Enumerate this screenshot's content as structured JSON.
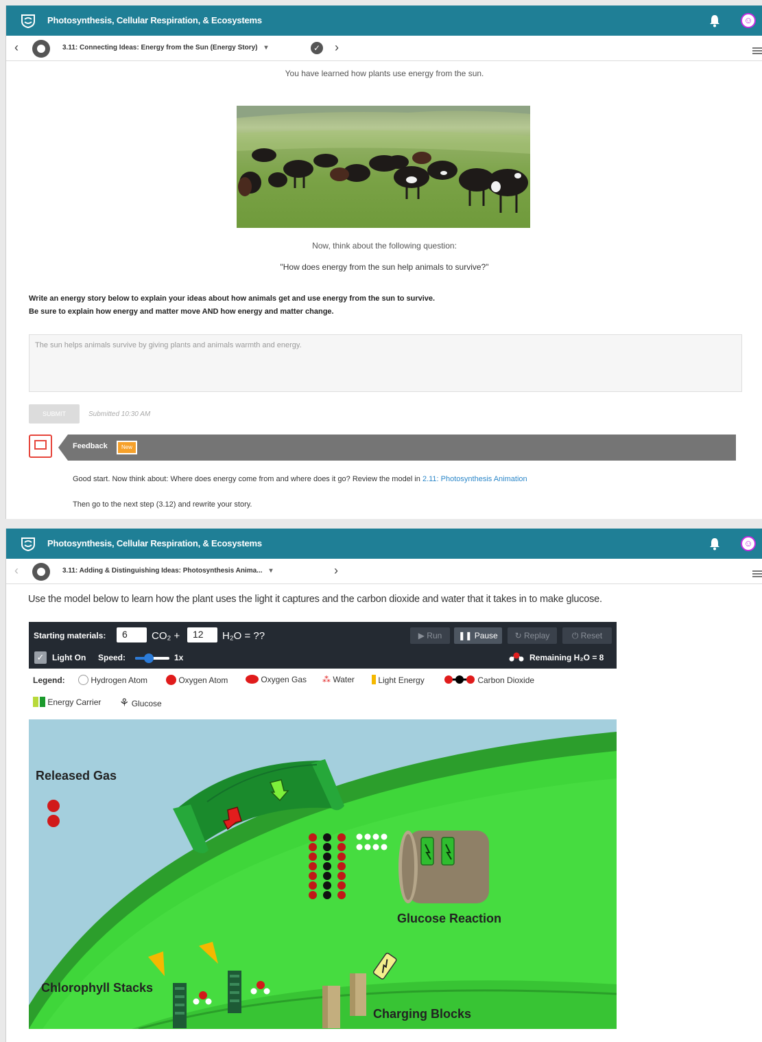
{
  "panel1": {
    "course_title": "Photosynthesis, Cellular Respiration, & Ecosystems",
    "step_title": "3.11: Connecting Ideas: Energy from the Sun (Energy Story)",
    "intro_text": "You have learned how plants use energy from the sun.",
    "think_text": "Now, think about the following question:",
    "question": "\"How does energy from the sun help animals to survive?\"",
    "prompt_line1": "Write an energy story below to explain your ideas about how animals get and use energy from the sun to survive.",
    "prompt_line2": "Be sure to explain how energy and matter move AND how energy and matter change.",
    "answer": "The sun helps animals survive by giving plants and animals warmth and energy.",
    "submit_label": "SUBMIT",
    "submitted_label": "Submitted 10:30 AM",
    "feedback_label": "Feedback",
    "feedback_badge": "New",
    "feedback_text": "Good start. Now think about: Where does energy come from and where does it go? Review the model in",
    "feedback_link": "2.11: Photosynthesis Animation",
    "feedback_text2": "Then go to the next step (3.12) and rewrite your story."
  },
  "panel2": {
    "course_title": "Photosynthesis, Cellular Respiration, & Ecosystems",
    "step_title": "3.11: Adding & Distinguishing Ideas: Photosynthesis Anima...",
    "intro_text": "Use the model below to learn how the plant uses the light it captures and the carbon dioxide and water that it takes in to make glucose.",
    "sim": {
      "starting_materials_label": "Starting materials:",
      "co2_value": "6",
      "co2_label": "CO₂ +",
      "h2o_value": "12",
      "h2o_label": "H₂O = ??",
      "run_label": "Run",
      "pause_label": "Pause",
      "replay_label": "Replay",
      "reset_label": "Reset",
      "light_on_label": "Light On",
      "speed_label": "Speed:",
      "speed_value": "1x",
      "remaining_label": "Remaining H₂O = 8",
      "legend_label": "Legend:",
      "legend": {
        "hydrogen": "Hydrogen Atom",
        "oxygen_atom": "Oxygen Atom",
        "oxygen_gas": "Oxygen Gas",
        "water": "Water",
        "light": "Light Energy",
        "co2": "Carbon Dioxide",
        "energy_carrier": "Energy Carrier",
        "glucose": "Glucose"
      },
      "labels": {
        "released_gas": "Released Gas",
        "glucose_reaction": "Glucose Reaction",
        "chlorophyll": "Chlorophyll Stacks",
        "charging": "Charging Blocks"
      }
    }
  },
  "colors": {
    "header": "#1f7f96",
    "avatar": "#c52be0",
    "feedback_bar": "#757575",
    "feedback_icon": "#e6453b",
    "badge": "#f6a12a",
    "link": "#2a86c8",
    "sim_toolbar": "#242a32",
    "cell_green": "#3fd63a"
  },
  "icons": [
    "logo-icon",
    "bell-icon",
    "avatar-icon",
    "chevron-left-icon",
    "chevron-right-icon",
    "check-circle-icon",
    "menu-icon",
    "feedback-icon",
    "play-icon",
    "pause-icon",
    "replay-icon",
    "reset-icon",
    "water-molecule-icon"
  ]
}
